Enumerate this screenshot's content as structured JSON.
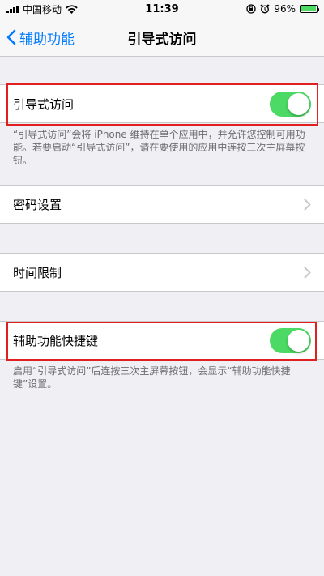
{
  "status_bar": {
    "carrier": "中国移动",
    "time": "11:39",
    "battery": "96%"
  },
  "nav": {
    "back_label": "辅助功能",
    "title": "引导式访问"
  },
  "guided_access": {
    "label": "引导式访问",
    "enabled": true,
    "footnote": "“引导式访问”会将 iPhone 维持在单个应用中，并允许您控制可用功能。若要启动“引导式访问”，请在要使用的应用中连按三次主屏幕按钮。"
  },
  "passcode_settings": {
    "label": "密码设置"
  },
  "time_limits": {
    "label": "时间限制"
  },
  "accessibility_shortcut": {
    "label": "辅助功能快捷键",
    "enabled": true,
    "footnote": "启用“引导式访问”后连按三次主屏幕按钮，会显示“辅助功能快捷键”设置。"
  },
  "colors": {
    "accent": "#007aff",
    "toggle_on": "#4cd964",
    "highlight": "#e02020"
  }
}
